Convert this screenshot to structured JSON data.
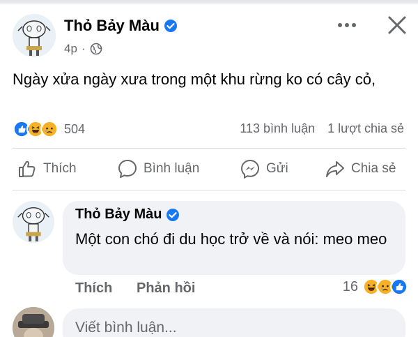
{
  "post": {
    "author": "Thỏ Bảy Màu",
    "time": "4p",
    "text": "Ngày xửa ngày xưa trong một khu rừng ko có cây cỏ,",
    "reaction_count": "504",
    "comments_count": "113 bình luận",
    "shares_count": "1 lượt chia sẻ"
  },
  "actions": {
    "like": "Thích",
    "comment": "Bình luận",
    "send": "Gửi",
    "share": "Chia sẻ"
  },
  "comment": {
    "author": "Thỏ Bảy Màu",
    "text": "Một con chó đi du học trở về và nói: meo meo",
    "like_label": "Thích",
    "reply_label": "Phản hồi",
    "reaction_count": "16"
  },
  "composer": {
    "placeholder": "Viết bình luận..."
  },
  "icons": {
    "post_reactions": [
      "like-icon",
      "haha-icon",
      "sad-icon"
    ],
    "comment_reactions": [
      "haha-icon",
      "sad-icon",
      "like-icon"
    ],
    "privacy": "globe-icon"
  },
  "colors": {
    "accent": "#1877f2",
    "secondary_text": "#65676b",
    "bubble": "#f0f2f5",
    "reaction_yellow": "#f7b125"
  }
}
